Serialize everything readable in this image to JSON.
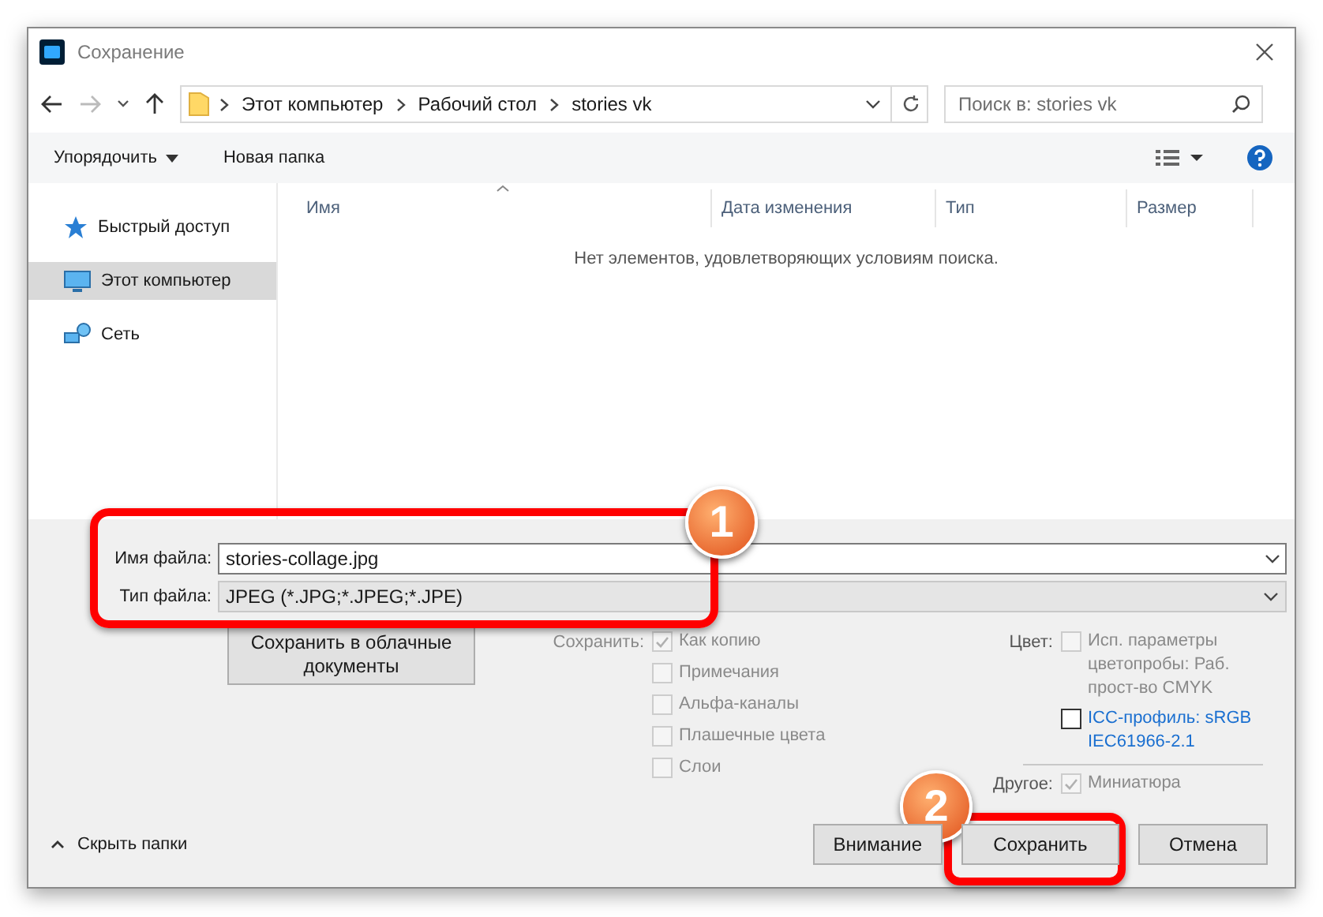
{
  "window": {
    "title": "Сохранение"
  },
  "navigation": {
    "path": [
      "Этот компьютер",
      "Рабочий стол",
      "stories vk"
    ],
    "search": {
      "placeholder": "Поиск в: stories vk"
    }
  },
  "toolbar": {
    "buttons": [
      {
        "label": "Упорядочить",
        "dropdown": true
      },
      {
        "label": "Новая папка",
        "dropdown": false
      }
    ]
  },
  "sidebar": {
    "items": [
      {
        "label": "Быстрый доступ",
        "kind": "star",
        "selected": false
      },
      {
        "label": "Этот компьютер",
        "kind": "computer",
        "selected": true
      },
      {
        "label": "Сеть",
        "kind": "network",
        "selected": false
      }
    ]
  },
  "file_list": {
    "columns": [
      "Имя",
      "Дата изменения",
      "Тип",
      "Размер"
    ],
    "empty_message": "Нет элементов, удовлетворяющих условиям поиска."
  },
  "file_name": {
    "label": "Имя файла:",
    "value": "stories-collage.jpg"
  },
  "file_type": {
    "label": "Тип файла:",
    "value": "JPEG (*.JPG;*.JPEG;*.JPE)"
  },
  "cloud_button": "Сохранить в облачные документы",
  "save_options": {
    "label": "Сохранить:",
    "items": [
      {
        "label": "Как копию",
        "checked": true,
        "disabled": true
      },
      {
        "label": "Примечания",
        "checked": false,
        "disabled": true
      },
      {
        "label": "Альфа-каналы",
        "checked": false,
        "disabled": true
      },
      {
        "label": "Плашечные цвета",
        "checked": false,
        "disabled": true
      },
      {
        "label": "Слои",
        "checked": false,
        "disabled": true
      }
    ]
  },
  "color_options": {
    "label": "Цвет:",
    "items": [
      {
        "label": "Исп. параметры цветопробы:  Раб. прост-во CMYK",
        "checked": false,
        "disabled": true
      },
      {
        "label": "ICC-профиль:  sRGB IEC61966-2.1",
        "checked": false,
        "disabled": false
      }
    ]
  },
  "other_options": {
    "label": "Другое:",
    "items": [
      {
        "label": "Миниатюра",
        "checked": true,
        "disabled": true
      }
    ]
  },
  "hide_folders": "Скрыть папки",
  "buttons": [
    {
      "label": "Внимание"
    },
    {
      "label": "Сохранить"
    },
    {
      "label": "Отмена"
    }
  ],
  "annotations": [
    {
      "number": "1"
    },
    {
      "number": "2"
    }
  ]
}
